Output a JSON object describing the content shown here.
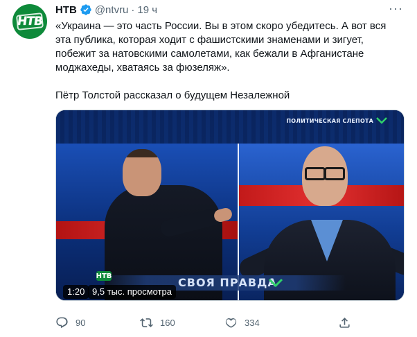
{
  "author": {
    "name": "НТВ",
    "handle": "@ntvru",
    "separator": "·",
    "time": "19 ч",
    "avatar_logo": "НТВ",
    "verified_icon": "verified-badge-icon"
  },
  "more_label": "···",
  "tweet": {
    "quote": "«Украина — это часть России. Вы в этом скоро убедитесь. А вот вся эта публика, которая ходит с фашистскими знаменами и зигует, побежит за натовскими самолетами, как бежали в Афганистане моджахеды, хватаясь за фюзеляж».",
    "caption": "Пётр Толстой рассказал о будущем Незалежной"
  },
  "video": {
    "overlay_tag": "ПОЛИТИЧЕСКАЯ СЛЕПОТА",
    "show_title": "СВОЯ ПРАВДА",
    "channel_logo": "НТВ",
    "duration": "1:20",
    "views": "9,5 тыс. просмотра"
  },
  "actions": {
    "reply_count": "90",
    "retweet_count": "160",
    "like_count": "334"
  },
  "colors": {
    "text": "#0f1419",
    "secondary": "#536471",
    "verified": "#1d9bf0",
    "ntv_green": "#0e8a3a"
  }
}
